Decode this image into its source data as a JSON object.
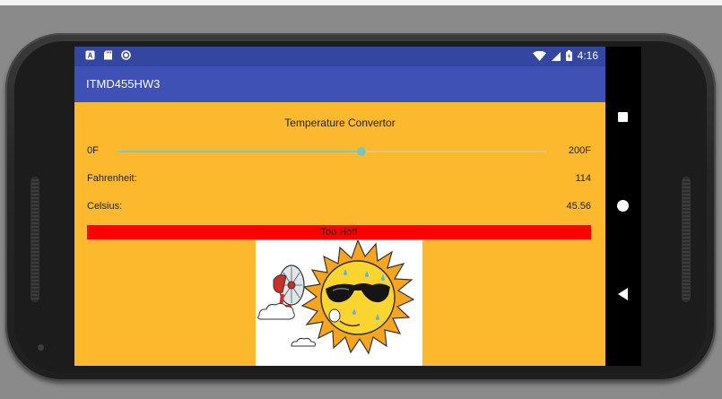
{
  "status_bar": {
    "icons": [
      "notification-a-icon",
      "sd-card-icon",
      "record-icon"
    ],
    "time": "4:16",
    "system_icons": [
      "wifi-icon",
      "signal-icon",
      "battery-icon"
    ]
  },
  "app_bar": {
    "title": "ITMD455HW3"
  },
  "main": {
    "heading": "Temperature Convertor",
    "slider": {
      "min_label": "0F",
      "max_label": "200F",
      "min": 0,
      "max": 200,
      "value": 114,
      "track_color": "#e6c77a",
      "accent_color": "#80c8c4"
    },
    "fahrenheit": {
      "label": "Fahrenheit:",
      "value": "114"
    },
    "celsius": {
      "label": "Celsius:",
      "value": "45.56"
    },
    "status_banner": {
      "text": "Too Hot!",
      "color": "#ff0000"
    },
    "image": {
      "subject": "sun-with-sunglasses-and-fan-icon"
    }
  },
  "navigation_bar": {
    "buttons": [
      "overview-square-icon",
      "home-circle-icon",
      "back-triangle-icon"
    ]
  },
  "colors": {
    "status_bar": "#3346a0",
    "app_bar": "#3f51b5",
    "content_bg": "#fdb92e",
    "device_frame": "#1f1f1f"
  }
}
